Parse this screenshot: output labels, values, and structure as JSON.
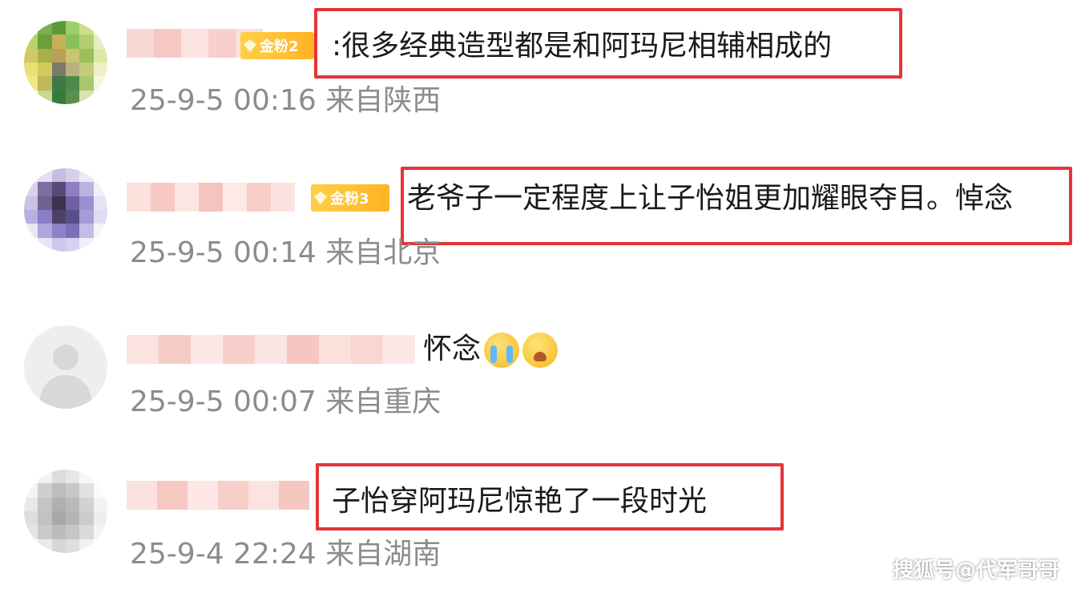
{
  "comments": [
    {
      "text": ":很多经典造型都是和阿玛尼相辅相成的",
      "meta": "25-9-5 00:16 来自陕西",
      "badge": "金粉2",
      "highlighted": true
    },
    {
      "text": "老爷子一定程度上让子怡姐更加耀眼夺目。悼念",
      "meta": "25-9-5 00:14 来自北京",
      "badge": "金粉3",
      "highlighted": true
    },
    {
      "text": "怀念",
      "meta": "25-9-5 00:07 来自重庆",
      "emojis": [
        "crying-face-emoji",
        "sobbing-face-emoji"
      ],
      "highlighted": false
    },
    {
      "text": "子怡穿阿玛尼惊艳了一段时光",
      "meta": "25-9-4 22:24 来自湖南",
      "highlighted": true
    }
  ],
  "watermark": "搜狐号@代军哥哥",
  "colors": {
    "highlight_border": "#e5343a",
    "meta_text": "#8c8c8c",
    "badge": "#ffb422"
  }
}
